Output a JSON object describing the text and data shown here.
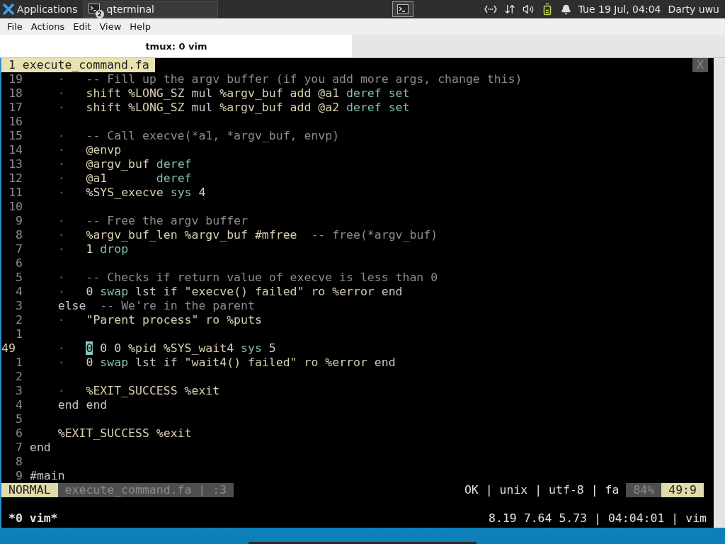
{
  "panel": {
    "apps_label": "Applications",
    "task": {
      "label": "qterminal",
      "badge": "2"
    },
    "clock": "Tue 19 Jul, 04:04",
    "user": "Darty uwu"
  },
  "menu": [
    "File",
    "Actions",
    "Edit",
    "View",
    "Help"
  ],
  "tabs": [
    {
      "label": "tmux: 0 vim",
      "selected": true
    }
  ],
  "vim": {
    "tabline": {
      "tab": "1 execute_command.fa",
      "close": "X"
    },
    "lines": [
      {
        "number": "19",
        "current": false,
        "tokens": [
          {
            "kind": "guide",
            "text": "    ·   "
          },
          {
            "kind": "comment",
            "text": "-- Fill up the argv buffer (if you add more args, change this)"
          }
        ]
      },
      {
        "number": "18",
        "current": false,
        "tokens": [
          {
            "kind": "guide",
            "text": "    ·   "
          },
          {
            "kind": "plain",
            "text": "shift %LONG_SZ "
          },
          {
            "kind": "control",
            "text": "mul"
          },
          {
            "kind": "plain",
            "text": " %argv_buf add @a1 "
          },
          {
            "kind": "builtin",
            "text": "deref set"
          }
        ]
      },
      {
        "number": "17",
        "current": false,
        "tokens": [
          {
            "kind": "guide",
            "text": "    ·   "
          },
          {
            "kind": "plain",
            "text": "shift %LONG_SZ "
          },
          {
            "kind": "control",
            "text": "mul"
          },
          {
            "kind": "plain",
            "text": " %argv_buf add @a2 "
          },
          {
            "kind": "builtin",
            "text": "deref set"
          }
        ]
      },
      {
        "number": "16",
        "current": false
      },
      {
        "number": "15",
        "current": false,
        "tokens": [
          {
            "kind": "guide",
            "text": "    ·   "
          },
          {
            "kind": "comment",
            "text": "-- Call execve(*a1, *argv_buf, envp)"
          }
        ]
      },
      {
        "number": "14",
        "current": false,
        "tokens": [
          {
            "kind": "guide",
            "text": "    ·   "
          },
          {
            "kind": "plain",
            "text": "@envp"
          }
        ]
      },
      {
        "number": "13",
        "current": false,
        "tokens": [
          {
            "kind": "guide",
            "text": "    ·   "
          },
          {
            "kind": "plain",
            "text": "@argv_buf "
          },
          {
            "kind": "builtin",
            "text": "deref"
          }
        ]
      },
      {
        "number": "12",
        "current": false,
        "tokens": [
          {
            "kind": "guide",
            "text": "    ·   "
          },
          {
            "kind": "plain",
            "text": "@a1       "
          },
          {
            "kind": "builtin",
            "text": "deref"
          }
        ]
      },
      {
        "number": "11",
        "current": false,
        "tokens": [
          {
            "kind": "guide",
            "text": "    ·   "
          },
          {
            "kind": "plain",
            "text": "%SYS_execve "
          },
          {
            "kind": "builtin",
            "text": "sys"
          },
          {
            "kind": "plain",
            "text": " 4"
          }
        ]
      },
      {
        "number": "10",
        "current": false
      },
      {
        "number": "9",
        "current": false,
        "tokens": [
          {
            "kind": "guide",
            "text": "    ·   "
          },
          {
            "kind": "comment",
            "text": "-- Free the argv buffer"
          }
        ]
      },
      {
        "number": "8",
        "current": false,
        "tokens": [
          {
            "kind": "guide",
            "text": "    ·   "
          },
          {
            "kind": "plain",
            "text": "%argv_buf_len %argv_buf #mfree  "
          },
          {
            "kind": "comment",
            "text": "-- free(*argv_buf)"
          }
        ]
      },
      {
        "number": "7",
        "current": false,
        "tokens": [
          {
            "kind": "guide",
            "text": "    ·   "
          },
          {
            "kind": "plain",
            "text": "1 "
          },
          {
            "kind": "builtin",
            "text": "drop"
          }
        ]
      },
      {
        "number": "6",
        "current": false
      },
      {
        "number": "5",
        "current": false,
        "tokens": [
          {
            "kind": "guide",
            "text": "    ·   "
          },
          {
            "kind": "comment",
            "text": "-- Checks if return value of execve is less than 0"
          }
        ]
      },
      {
        "number": "4",
        "current": false,
        "tokens": [
          {
            "kind": "guide",
            "text": "    ·   "
          },
          {
            "kind": "plain",
            "text": "0 "
          },
          {
            "kind": "builtin",
            "text": "swap"
          },
          {
            "kind": "control",
            "text": " lst if "
          },
          {
            "kind": "plain",
            "text": "\"execve() failed\" ro %error "
          },
          {
            "kind": "control",
            "text": "end"
          }
        ]
      },
      {
        "number": "3",
        "current": false,
        "tokens": [
          {
            "kind": "control",
            "text": "    else  "
          },
          {
            "kind": "comment",
            "text": "-- We're in the parent"
          }
        ]
      },
      {
        "number": "2",
        "current": false,
        "tokens": [
          {
            "kind": "guide",
            "text": "    ·   "
          },
          {
            "kind": "plain",
            "text": "\"Parent process\" ro %puts"
          }
        ]
      },
      {
        "number": "1",
        "current": false
      },
      {
        "number": "49",
        "current": true,
        "tokens": [
          {
            "kind": "guide",
            "text": "    ·   "
          },
          {
            "kind": "cursor",
            "text": "0"
          },
          {
            "kind": "plain",
            "text": " 0 0 %pid %SYS_wait4 "
          },
          {
            "kind": "builtin",
            "text": "sys"
          },
          {
            "kind": "plain",
            "text": " 5"
          }
        ]
      },
      {
        "number": "1",
        "current": false,
        "tokens": [
          {
            "kind": "guide",
            "text": "    ·   "
          },
          {
            "kind": "plain",
            "text": "0 "
          },
          {
            "kind": "builtin",
            "text": "swap"
          },
          {
            "kind": "control",
            "text": " lst if "
          },
          {
            "kind": "plain",
            "text": "\"wait4() failed\" ro %error "
          },
          {
            "kind": "control",
            "text": "end"
          }
        ]
      },
      {
        "number": "2",
        "current": false
      },
      {
        "number": "3",
        "current": false,
        "tokens": [
          {
            "kind": "guide",
            "text": "    ·   "
          },
          {
            "kind": "plain",
            "text": "%EXIT_SUCCESS %exit"
          }
        ]
      },
      {
        "number": "4",
        "current": false,
        "tokens": [
          {
            "kind": "control",
            "text": "    end end"
          }
        ]
      },
      {
        "number": "5",
        "current": false
      },
      {
        "number": "6",
        "current": false,
        "tokens": [
          {
            "kind": "plain",
            "text": "    %EXIT_SUCCESS %exit"
          }
        ]
      },
      {
        "number": "7",
        "current": false,
        "tokens": [
          {
            "kind": "control",
            "text": "end"
          }
        ]
      },
      {
        "number": "8",
        "current": false
      },
      {
        "number": "9",
        "current": false,
        "tokens": [
          {
            "kind": "control",
            "text": "#main"
          }
        ]
      }
    ],
    "statusline": {
      "mode": "NORMAL",
      "file": "execute_command.fa | :3",
      "info": "OK | unix | utf-8 | fa",
      "percent": "84%",
      "position": "49:9"
    }
  },
  "tmux": {
    "window": "*0 vim*",
    "status": "8.19 7.64 5.73 | 04:04:01 | vim"
  }
}
